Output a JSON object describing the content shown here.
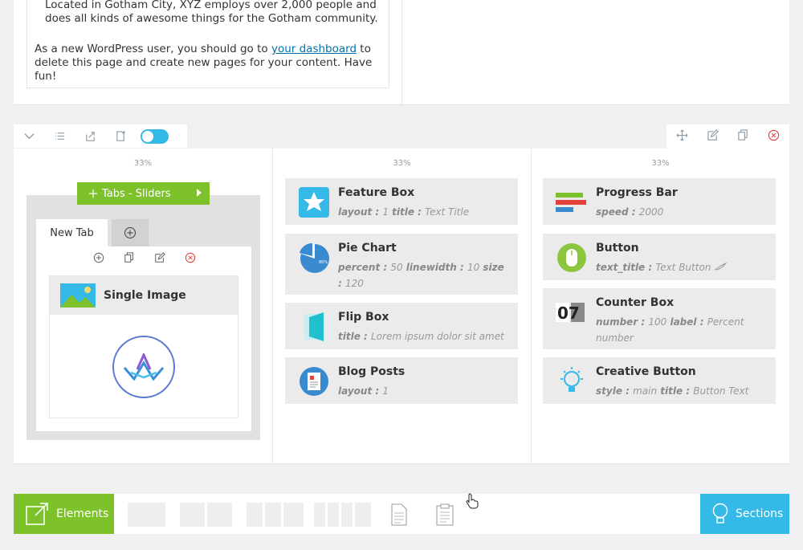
{
  "top_text": {
    "para1": "been providing quality doohickeys to the public ever since. Located in Gotham City, XYZ employs over 2,000 people and does all kinds of awesome things for the Gotham community.",
    "para2_before": "As a new WordPress user, you should go to ",
    "para2_link": "your dashboard",
    "para2_after": " to delete this page and create new pages for your content. Have fun!"
  },
  "columns": {
    "col1_pct": "33%",
    "col2_pct": "33%",
    "col3_pct": "33%"
  },
  "tabs_widget": {
    "handle_label": "Tabs - Sliders",
    "tab_label": "New Tab",
    "single_image_label": "Single Image"
  },
  "elements_col2": [
    {
      "title": "Feature Box",
      "sub": [
        [
          "layout : ",
          "1"
        ],
        [
          " title : ",
          "Text Title"
        ]
      ]
    },
    {
      "title": "Pie Chart",
      "sub": [
        [
          "percent : ",
          "50"
        ],
        [
          " linewidth : ",
          "10"
        ],
        [
          " size : ",
          "120"
        ]
      ]
    },
    {
      "title": "Flip Box",
      "sub": [
        [
          "title : ",
          "Lorem ipsum dolor sit amet"
        ]
      ]
    },
    {
      "title": "Blog Posts",
      "sub": [
        [
          "layout : ",
          "1"
        ]
      ]
    }
  ],
  "elements_col3": [
    {
      "title": "Progress Bar",
      "sub": [
        [
          "speed : ",
          "2000"
        ]
      ]
    },
    {
      "title": "Button",
      "sub": [
        [
          "text_title : ",
          "Text Button"
        ]
      ]
    },
    {
      "title": "Counter Box",
      "sub": [
        [
          "number : ",
          "100"
        ],
        [
          " label : ",
          "Percent number"
        ]
      ]
    },
    {
      "title": "Creative Button",
      "sub": [
        [
          "style : ",
          "main"
        ],
        [
          " title : ",
          "Button Text"
        ]
      ]
    }
  ],
  "pie_badge": "80%",
  "counter_digits": "07",
  "bottom_bar": {
    "elements_label": "Elements",
    "sections_label": "Sections"
  },
  "colors": {
    "green": "#7dc12b",
    "blue": "#35b9e6",
    "link": "#0073aa",
    "delete_red": "#e2423a"
  }
}
